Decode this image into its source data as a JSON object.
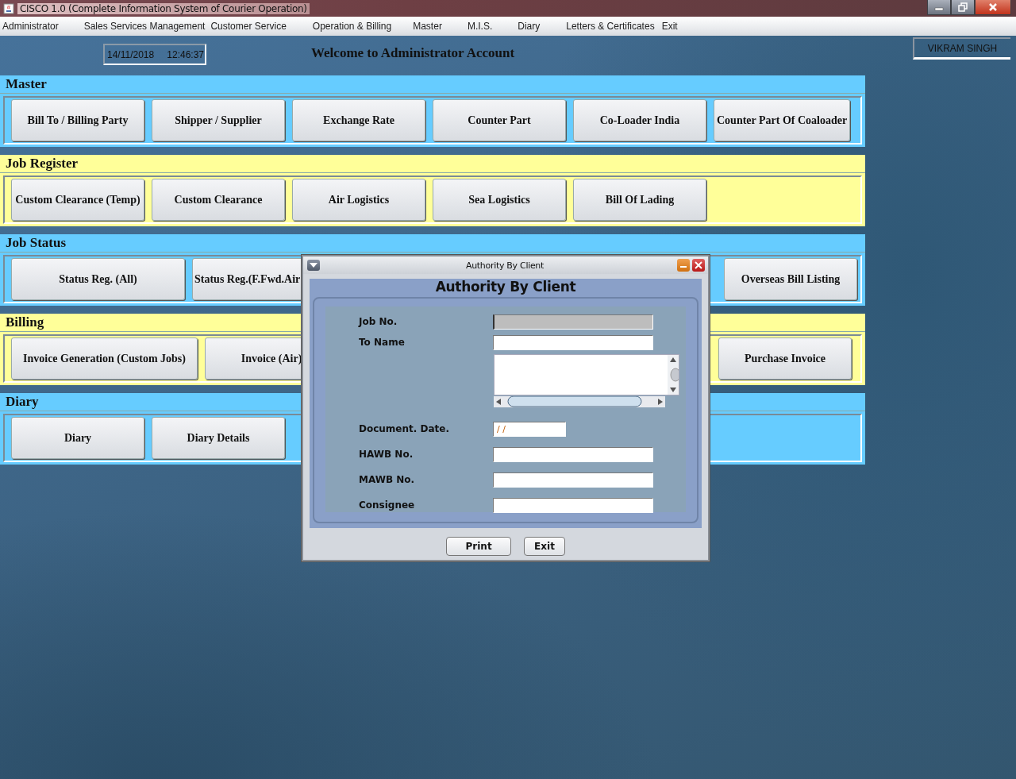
{
  "window": {
    "title": "CISCO 1.0 (Complete Information System of Courier Operation)"
  },
  "menu": [
    "Administrator",
    "Sales Services Management",
    "Customer Service",
    "Operation & Billing",
    "Master",
    "M.I.S.",
    "Diary",
    "Letters & Certificates",
    "Exit"
  ],
  "header": {
    "date": "14/11/2018",
    "time": "12:46:37",
    "welcome": "Welcome to Administrator Account",
    "user": "VIKRAM SINGH"
  },
  "sections": [
    {
      "title": "Master",
      "color": "#66ccff",
      "buttons": [
        "Bill To / Billing Party",
        "Shipper / Supplier",
        "Exchange Rate",
        "Counter Part",
        "Co-Loader India",
        "Counter Part Of Coaloader"
      ]
    },
    {
      "title": "Job Register",
      "color": "#ffff99",
      "buttons": [
        "Custom Clearance (Temp)",
        "Custom Clearance",
        "Air Logistics",
        "Sea Logistics",
        "Bill Of Lading"
      ]
    },
    {
      "title": "Job Status",
      "color": "#66ccff",
      "buttons": [
        "Status Reg. (All)",
        "Status Reg.(F.Fwd.Air",
        "Overseas Bill Listing"
      ]
    },
    {
      "title": "Billing",
      "color": "#ffff99",
      "buttons": [
        "Invoice Generation (Custom Jobs)",
        "Invoice (Air)",
        "Purchase Invoice"
      ]
    },
    {
      "title": "Diary",
      "color": "#66ccff",
      "buttons": [
        "Diary",
        "Diary Details"
      ]
    }
  ],
  "dialog": {
    "title": "Authority By Client",
    "heading": "Authority By Client",
    "fields": [
      {
        "kind": "text",
        "label": "Job No.",
        "disabled": true
      },
      {
        "kind": "text",
        "label": "To Name",
        "disabled": false
      },
      {
        "kind": "textarea"
      },
      {
        "kind": "date",
        "label": "Document. Date.",
        "value": "/ /"
      },
      {
        "kind": "text",
        "label": "HAWB No.",
        "disabled": false
      },
      {
        "kind": "text",
        "label": "MAWB No.",
        "disabled": false
      },
      {
        "kind": "text",
        "label": "Consignee",
        "disabled": false
      }
    ],
    "buttons": [
      "Print",
      "Exit"
    ]
  }
}
